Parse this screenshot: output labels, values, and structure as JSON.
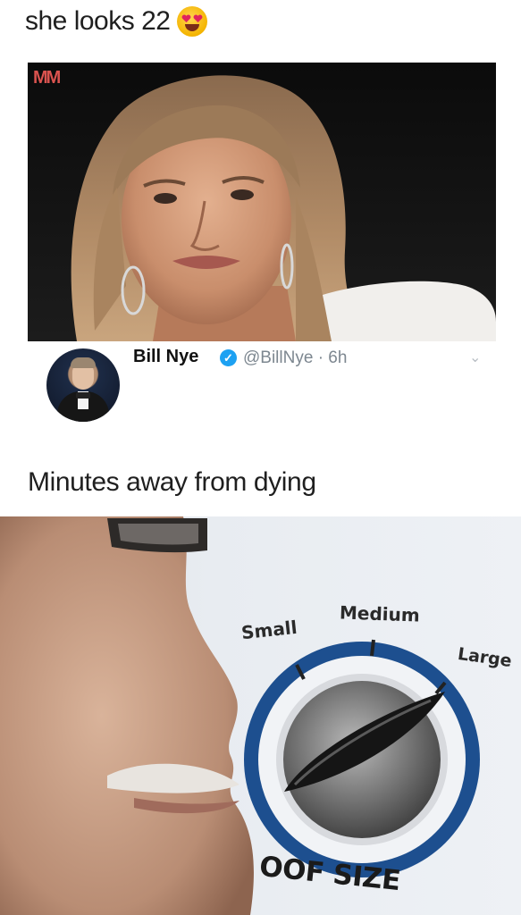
{
  "top_caption": {
    "text": "she looks 22",
    "emoji": "heart-eyes-emoji"
  },
  "photo": {
    "watermark": "MM"
  },
  "tweet": {
    "name": "Bill Nye",
    "handle_time": "@BillNye · 6h",
    "verified_icon": "verified-badge-icon",
    "menu_icon": "chevron-down-icon",
    "verified_glyph": "✓",
    "chevron_glyph": "⌄"
  },
  "bottom_caption": {
    "text": "Minutes away from dying"
  },
  "oof_dial": {
    "label_small": "Small",
    "label_medium": "Medium",
    "label_large": "Large",
    "title": "OOF SIZE",
    "ring_color": "#1d4f8f"
  }
}
